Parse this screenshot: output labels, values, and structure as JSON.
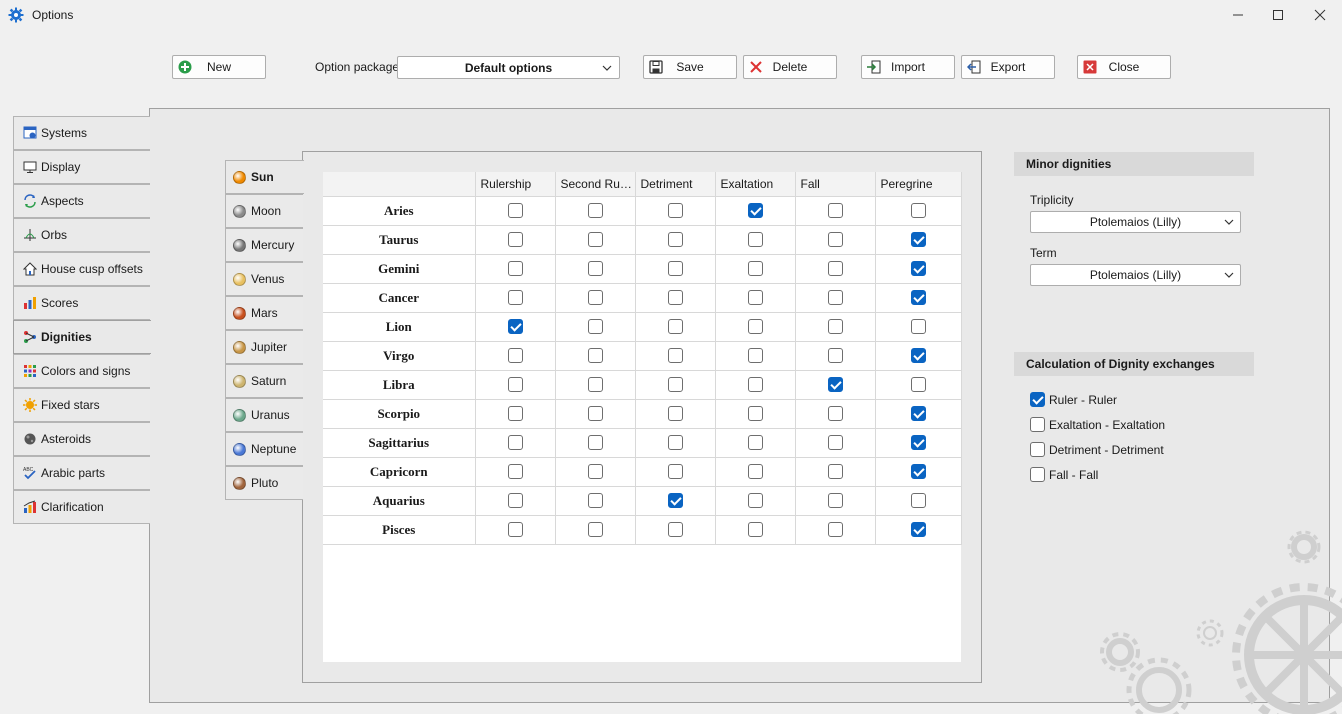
{
  "window": {
    "title": "Options"
  },
  "toolbar": {
    "new_label": "New",
    "package_label": "Option package",
    "package_value": "Default options",
    "save_label": "Save",
    "delete_label": "Delete",
    "import_label": "Import",
    "export_label": "Export",
    "close_label": "Close"
  },
  "sidebar": {
    "active_index": 6,
    "items": [
      {
        "label": "Systems",
        "icon": "systems-icon"
      },
      {
        "label": "Display",
        "icon": "monitor-icon"
      },
      {
        "label": "Aspects",
        "icon": "aspects-icon"
      },
      {
        "label": "Orbs",
        "icon": "orbs-icon"
      },
      {
        "label": "House cusp offsets",
        "icon": "house-icon"
      },
      {
        "label": "Scores",
        "icon": "bar-chart-icon"
      },
      {
        "label": "Dignities",
        "icon": "dignities-icon"
      },
      {
        "label": "Colors and signs",
        "icon": "palette-grid-icon"
      },
      {
        "label": "Fixed stars",
        "icon": "star-icon"
      },
      {
        "label": "Asteroids",
        "icon": "asteroid-icon"
      },
      {
        "label": "Arabic parts",
        "icon": "abc-check-icon"
      },
      {
        "label": "Clarification",
        "icon": "clarification-icon"
      }
    ]
  },
  "planets": {
    "active_index": 0,
    "items": [
      {
        "label": "Sun",
        "color": "#f08a00"
      },
      {
        "label": "Moon",
        "color": "#8a8a8a"
      },
      {
        "label": "Mercury",
        "color": "#777777"
      },
      {
        "label": "Venus",
        "color": "#e8c060"
      },
      {
        "label": "Mars",
        "color": "#c8501e"
      },
      {
        "label": "Jupiter",
        "color": "#c89646"
      },
      {
        "label": "Saturn",
        "color": "#cdb46e"
      },
      {
        "label": "Uranus",
        "color": "#6ca88c"
      },
      {
        "label": "Neptune",
        "color": "#4a78d6"
      },
      {
        "label": "Pluto",
        "color": "#a0643c"
      }
    ]
  },
  "grid": {
    "columns": [
      "Rulership",
      "Second Rulership",
      "Detriment",
      "Exaltation",
      "Fall",
      "Peregrine"
    ],
    "rows": [
      {
        "sign": "Aries",
        "checks": [
          false,
          false,
          false,
          true,
          false,
          false
        ]
      },
      {
        "sign": "Taurus",
        "checks": [
          false,
          false,
          false,
          false,
          false,
          true
        ]
      },
      {
        "sign": "Gemini",
        "checks": [
          false,
          false,
          false,
          false,
          false,
          true
        ]
      },
      {
        "sign": "Cancer",
        "checks": [
          false,
          false,
          false,
          false,
          false,
          true
        ]
      },
      {
        "sign": "Lion",
        "checks": [
          true,
          false,
          false,
          false,
          false,
          false
        ]
      },
      {
        "sign": "Virgo",
        "checks": [
          false,
          false,
          false,
          false,
          false,
          true
        ]
      },
      {
        "sign": "Libra",
        "checks": [
          false,
          false,
          false,
          false,
          true,
          false
        ]
      },
      {
        "sign": "Scorpio",
        "checks": [
          false,
          false,
          false,
          false,
          false,
          true
        ]
      },
      {
        "sign": "Sagittarius",
        "checks": [
          false,
          false,
          false,
          false,
          false,
          true
        ]
      },
      {
        "sign": "Capricorn",
        "checks": [
          false,
          false,
          false,
          false,
          false,
          true
        ]
      },
      {
        "sign": "Aquarius",
        "checks": [
          false,
          false,
          true,
          false,
          false,
          false
        ]
      },
      {
        "sign": "Pisces",
        "checks": [
          false,
          false,
          false,
          false,
          false,
          true
        ]
      }
    ]
  },
  "minor": {
    "heading": "Minor dignities",
    "triplicity_label": "Triplicity",
    "triplicity_value": "Ptolemaios (Lilly)",
    "term_label": "Term",
    "term_value": "Ptolemaios (Lilly)"
  },
  "exchanges": {
    "heading": "Calculation of Dignity exchanges",
    "items": [
      {
        "label": "Ruler - Ruler",
        "checked": true
      },
      {
        "label": "Exaltation - Exaltation",
        "checked": false
      },
      {
        "label": "Detriment - Detriment",
        "checked": false
      },
      {
        "label": "Fall - Fall",
        "checked": false
      }
    ]
  },
  "colors": {
    "accent": "#0a64c2",
    "new_green": "#2a9d4a",
    "delete_red": "#d33",
    "close_red": "#d73a3a"
  }
}
